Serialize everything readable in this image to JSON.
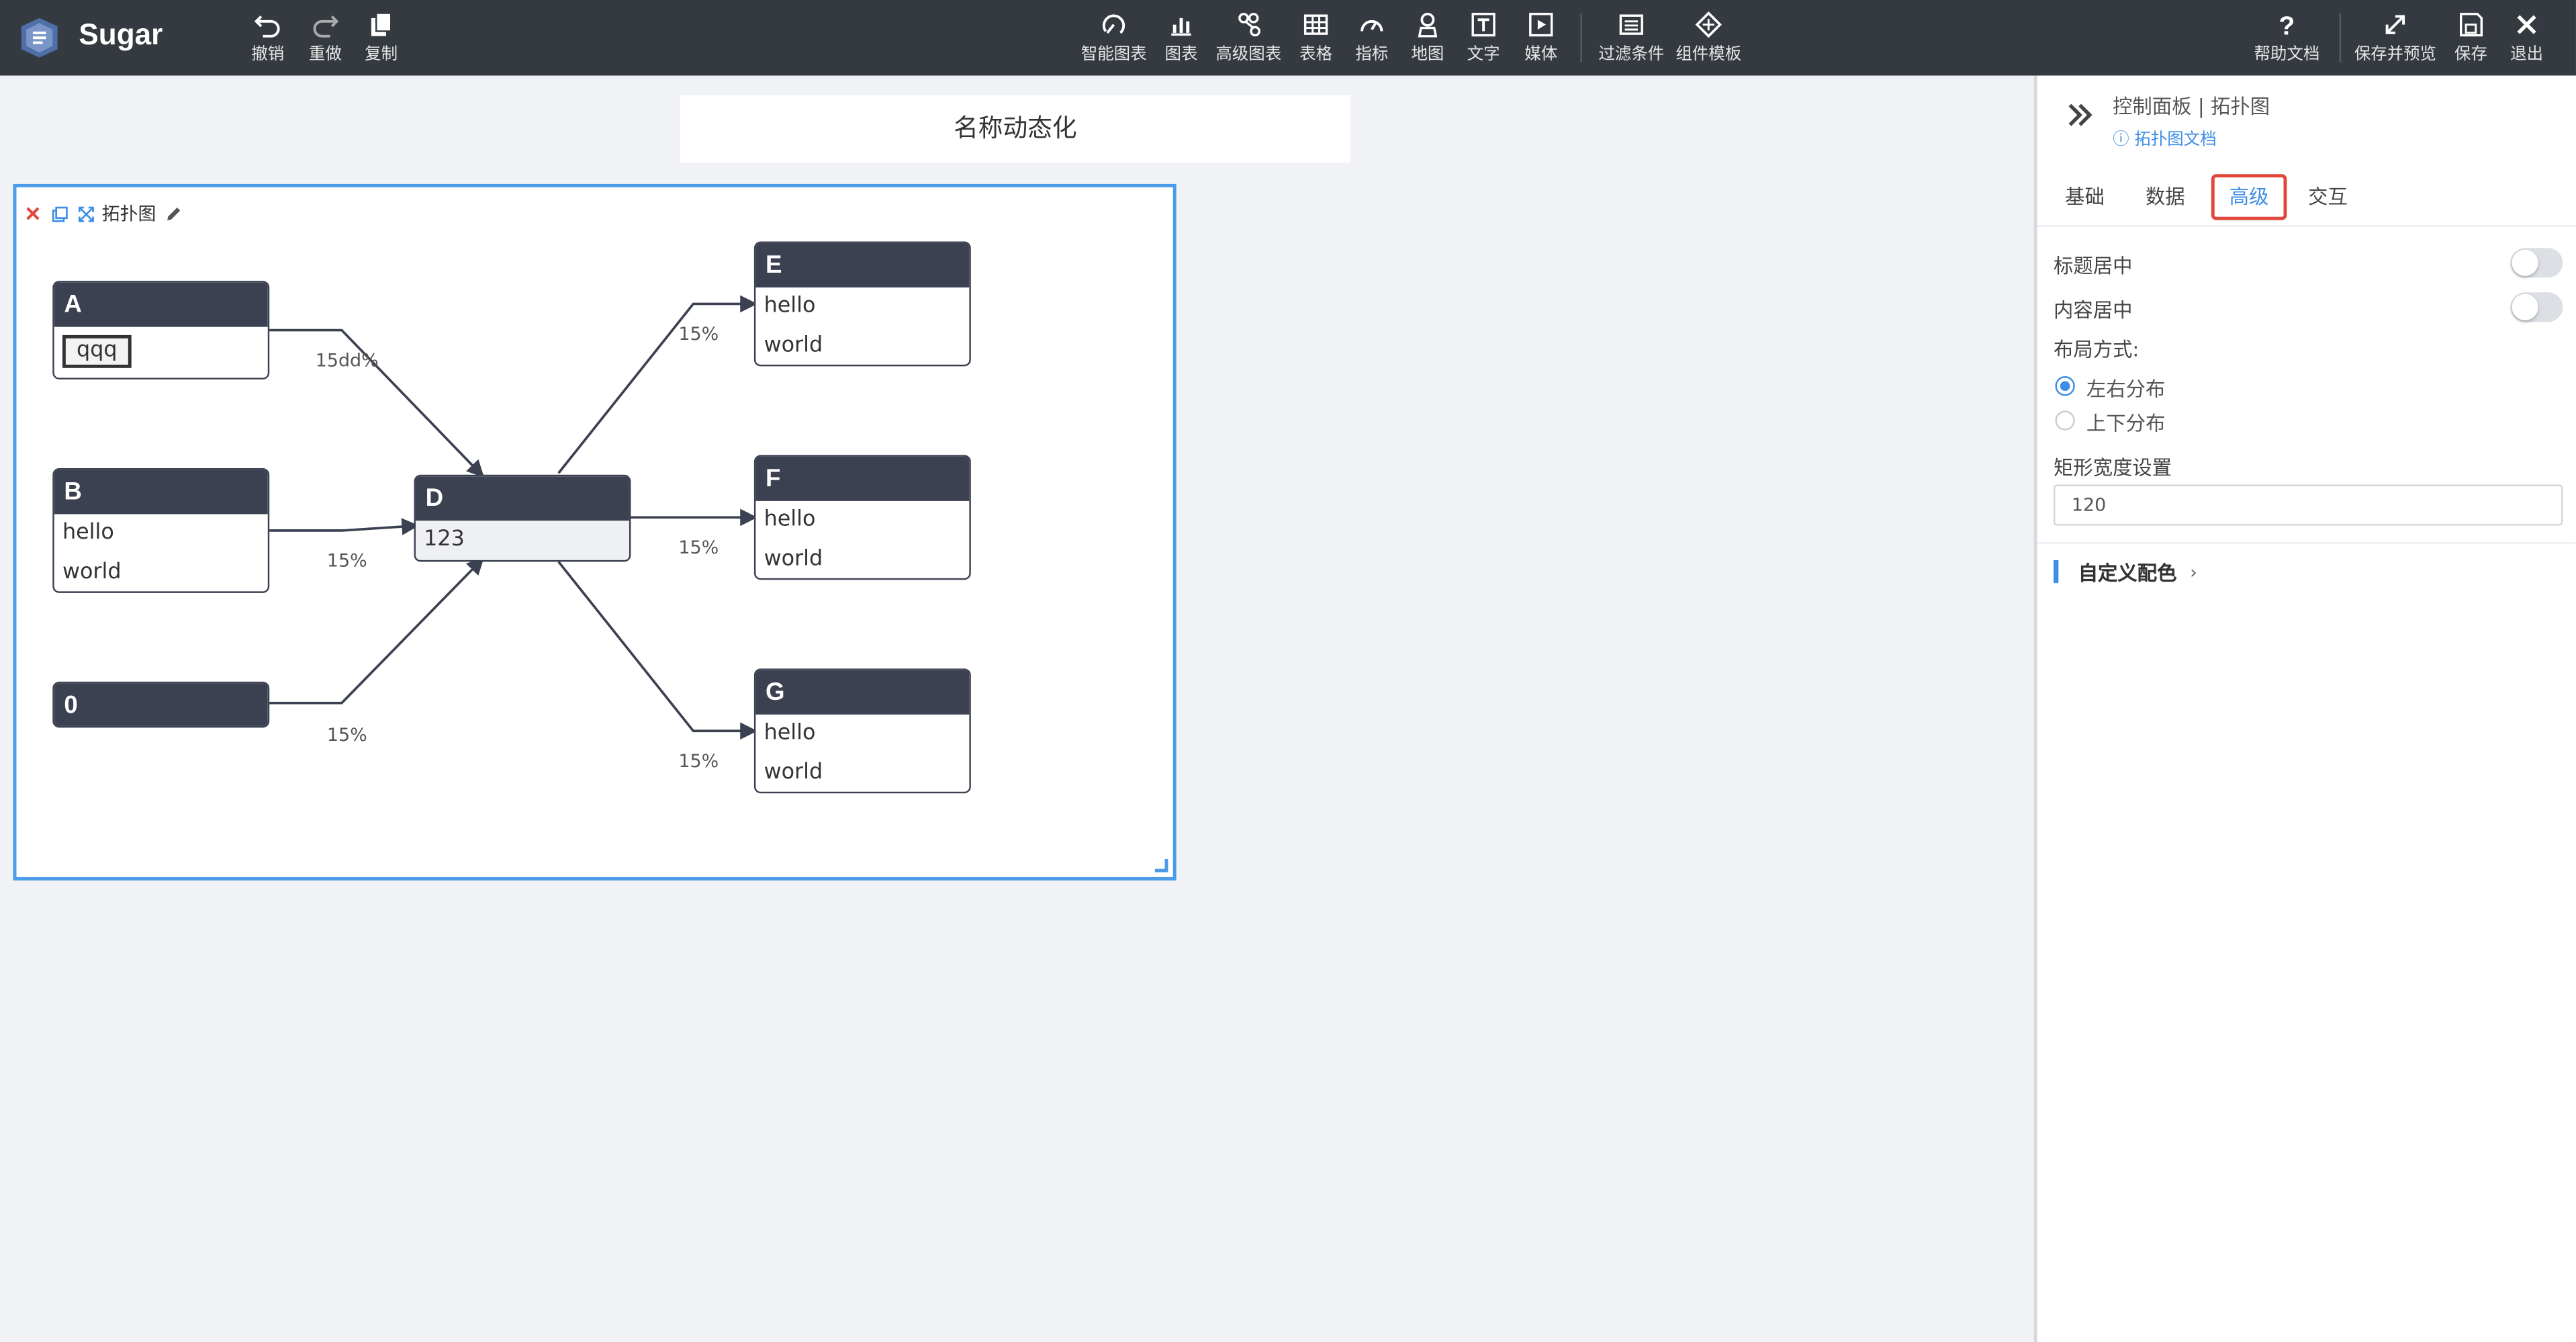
{
  "app": {
    "brand": "Sugar"
  },
  "toolbar": {
    "left": [
      {
        "label": "撤销",
        "icon": "undo-icon"
      },
      {
        "label": "重做",
        "icon": "redo-icon"
      },
      {
        "label": "复制",
        "icon": "copy-icon"
      }
    ],
    "center": [
      {
        "label": "智能图表",
        "icon": "smart-chart-icon"
      },
      {
        "label": "图表",
        "icon": "bar-chart-icon"
      },
      {
        "label": "高级图表",
        "icon": "advanced-chart-icon"
      },
      {
        "label": "表格",
        "icon": "table-icon"
      },
      {
        "label": "指标",
        "icon": "gauge-icon"
      },
      {
        "label": "地图",
        "icon": "map-icon"
      },
      {
        "label": "文字",
        "icon": "text-icon"
      },
      {
        "label": "媒体",
        "icon": "media-icon"
      },
      {
        "label": "过滤条件",
        "icon": "filter-icon"
      },
      {
        "label": "组件模板",
        "icon": "template-icon"
      }
    ],
    "right": [
      {
        "label": "帮助文档",
        "icon": "help-icon"
      },
      {
        "label": "保存并预览",
        "icon": "expand-icon"
      },
      {
        "label": "保存",
        "icon": "save-icon"
      },
      {
        "label": "退出",
        "icon": "close-icon"
      }
    ]
  },
  "canvas": {
    "title": "名称动态化",
    "widget": {
      "name": "拓扑图",
      "nodes": {
        "A": {
          "title": "A",
          "input_value": "qqq"
        },
        "B": {
          "title": "B",
          "rows": [
            "hello",
            "world"
          ]
        },
        "O": {
          "title": "0"
        },
        "D": {
          "title": "D",
          "rows": [
            "123"
          ]
        },
        "E": {
          "title": "E",
          "rows": [
            "hello",
            "world"
          ]
        },
        "F": {
          "title": "F",
          "rows": [
            "hello",
            "world"
          ]
        },
        "G": {
          "title": "G",
          "rows": [
            "hello",
            "world"
          ]
        }
      },
      "edges": {
        "a_d": "15dd%",
        "b_d": "15%",
        "o_d": "15%",
        "d_e": "15%",
        "d_f": "15%",
        "d_g": "15%"
      }
    }
  },
  "panel": {
    "title": "控制面板 | 拓扑图",
    "doc_link": "拓扑图文档",
    "tabs": [
      "基础",
      "数据",
      "高级",
      "交互"
    ],
    "active_tab": "高级",
    "title_center_label": "标题居中",
    "content_center_label": "内容居中",
    "layout_label": "布局方式:",
    "layout_options": [
      "左右分布",
      "上下分布"
    ],
    "layout_selected": "左右分布",
    "rect_width_label": "矩形宽度设置",
    "rect_width_value": "120",
    "custom_color_label": "自定义配色"
  },
  "colors": {
    "topbar": "#343a40",
    "node_header": "#3c4152",
    "accent": "#3d8ee6",
    "highlight": "#e0473a"
  }
}
